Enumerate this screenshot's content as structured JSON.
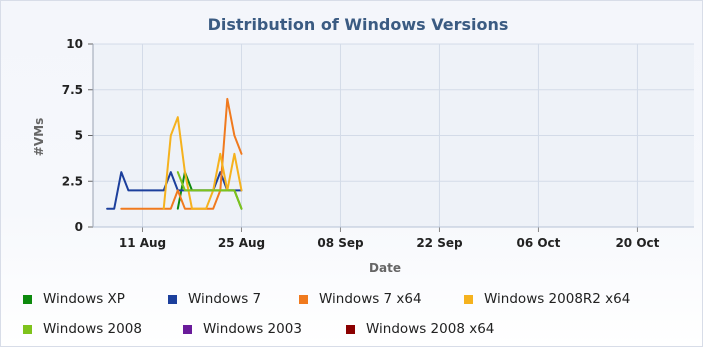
{
  "chart_data": {
    "type": "line",
    "title": "Distribution of Windows Versions",
    "xlabel": "Date",
    "ylabel": "#VMs",
    "x_range": [
      "2012-08-04",
      "2012-10-28"
    ],
    "x_ticks": [
      {
        "date": "2012-08-11",
        "label": "11 Aug"
      },
      {
        "date": "2012-08-25",
        "label": "25 Aug"
      },
      {
        "date": "2012-09-08",
        "label": "08 Sep"
      },
      {
        "date": "2012-09-22",
        "label": "22 Sep"
      },
      {
        "date": "2012-10-06",
        "label": "06 Oct"
      },
      {
        "date": "2012-10-20",
        "label": "20 Oct"
      }
    ],
    "ylim": [
      0,
      10
    ],
    "y_ticks": [
      {
        "value": 0,
        "label": "0"
      },
      {
        "value": 2.5,
        "label": "2.5"
      },
      {
        "value": 5,
        "label": "5"
      },
      {
        "value": 7.5,
        "label": "7.5"
      },
      {
        "value": 10,
        "label": "10"
      }
    ],
    "grid": true,
    "legend_position": "bottom",
    "series": [
      {
        "name": "Windows XP",
        "color": "#0d8a0d",
        "points": [
          [
            "2012-08-16",
            1
          ],
          [
            "2012-08-17",
            3
          ],
          [
            "2012-08-18",
            2
          ],
          [
            "2012-08-19",
            2
          ],
          [
            "2012-08-20",
            2
          ],
          [
            "2012-08-21",
            2
          ],
          [
            "2012-08-22",
            2
          ],
          [
            "2012-08-23",
            2
          ],
          [
            "2012-08-24",
            2
          ],
          [
            "2012-08-25",
            1
          ]
        ]
      },
      {
        "name": "Windows 7",
        "color": "#1c3f9c",
        "points": [
          [
            "2012-08-06",
            1
          ],
          [
            "2012-08-07",
            1
          ],
          [
            "2012-08-08",
            3
          ],
          [
            "2012-08-09",
            2
          ],
          [
            "2012-08-10",
            2
          ],
          [
            "2012-08-11",
            2
          ],
          [
            "2012-08-12",
            2
          ],
          [
            "2012-08-13",
            2
          ],
          [
            "2012-08-14",
            2
          ],
          [
            "2012-08-15",
            3
          ],
          [
            "2012-08-16",
            2
          ],
          [
            "2012-08-17",
            2
          ],
          [
            "2012-08-18",
            2
          ],
          [
            "2012-08-19",
            2
          ],
          [
            "2012-08-20",
            2
          ],
          [
            "2012-08-21",
            2
          ],
          [
            "2012-08-22",
            3
          ],
          [
            "2012-08-23",
            2
          ],
          [
            "2012-08-24",
            2
          ],
          [
            "2012-08-25",
            2
          ]
        ]
      },
      {
        "name": "Windows 7 x64",
        "color": "#f07a1e",
        "points": [
          [
            "2012-08-08",
            1
          ],
          [
            "2012-08-09",
            1
          ],
          [
            "2012-08-10",
            1
          ],
          [
            "2012-08-11",
            1
          ],
          [
            "2012-08-12",
            1
          ],
          [
            "2012-08-13",
            1
          ],
          [
            "2012-08-14",
            1
          ],
          [
            "2012-08-15",
            1
          ],
          [
            "2012-08-16",
            2
          ],
          [
            "2012-08-17",
            1
          ],
          [
            "2012-08-18",
            1
          ],
          [
            "2012-08-19",
            1
          ],
          [
            "2012-08-20",
            1
          ],
          [
            "2012-08-21",
            1
          ],
          [
            "2012-08-22",
            2
          ],
          [
            "2012-08-23",
            7
          ],
          [
            "2012-08-24",
            5
          ],
          [
            "2012-08-25",
            4
          ]
        ]
      },
      {
        "name": "Windows 2008R2 x64",
        "color": "#f5b21e",
        "points": [
          [
            "2012-08-14",
            1
          ],
          [
            "2012-08-15",
            5
          ],
          [
            "2012-08-16",
            6
          ],
          [
            "2012-08-17",
            3
          ],
          [
            "2012-08-18",
            1
          ],
          [
            "2012-08-19",
            1
          ],
          [
            "2012-08-20",
            1
          ],
          [
            "2012-08-21",
            2
          ],
          [
            "2012-08-22",
            4
          ],
          [
            "2012-08-23",
            2
          ],
          [
            "2012-08-24",
            4
          ],
          [
            "2012-08-25",
            2
          ]
        ]
      },
      {
        "name": "Windows 2008",
        "color": "#7fc31c",
        "points": [
          [
            "2012-08-16",
            3
          ],
          [
            "2012-08-17",
            2
          ],
          [
            "2012-08-18",
            2
          ],
          [
            "2012-08-19",
            2
          ],
          [
            "2012-08-20",
            2
          ],
          [
            "2012-08-21",
            2
          ],
          [
            "2012-08-22",
            2
          ],
          [
            "2012-08-23",
            2
          ],
          [
            "2012-08-24",
            2
          ],
          [
            "2012-08-25",
            1
          ]
        ]
      },
      {
        "name": "Windows 2003",
        "color": "#6a1b9a",
        "points": []
      },
      {
        "name": "Windows 2008 x64",
        "color": "#8b0000",
        "points": []
      }
    ]
  }
}
